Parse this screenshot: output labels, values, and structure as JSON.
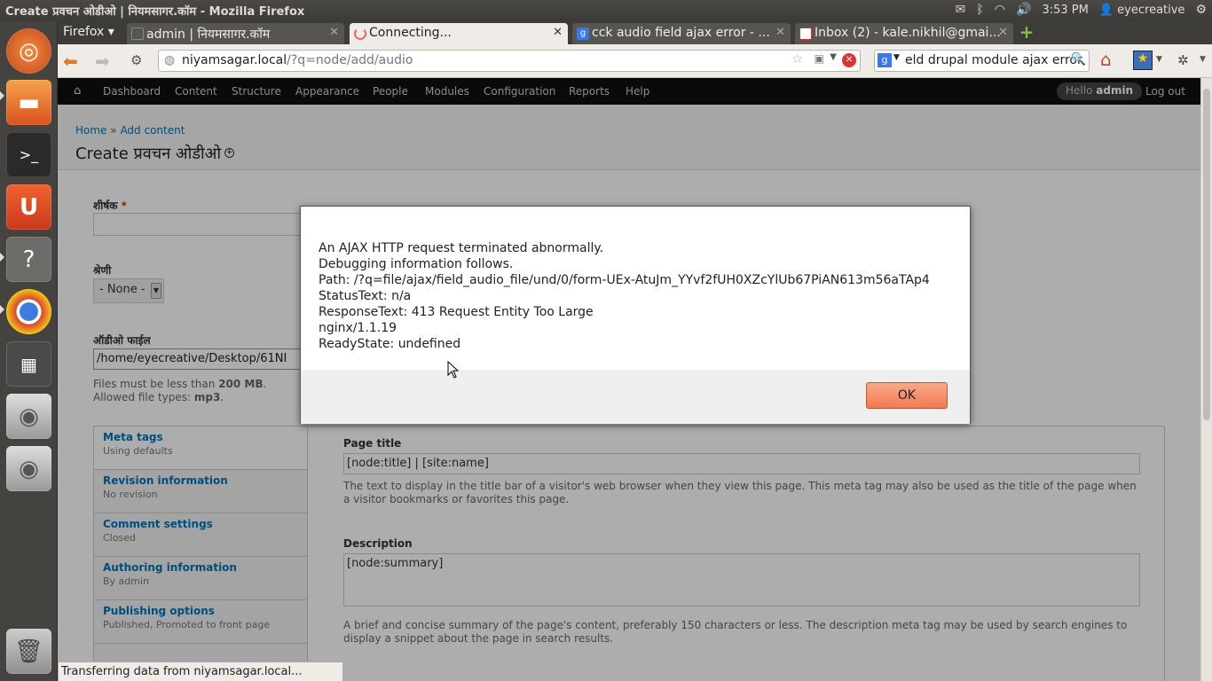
{
  "window": {
    "title": "Create प्रवचन ओडीओ | नियमसागर.कॉम - Mozilla Firefox"
  },
  "tray": {
    "time": "3:53 PM",
    "user": "eyecreative"
  },
  "browser": {
    "firefox_menu": "Firefox",
    "tabs": [
      {
        "label": "admin | नियमसागर.कॉम",
        "active": false
      },
      {
        "label": "Connecting...",
        "active": true
      },
      {
        "label": "cck audio field ajax error - ...",
        "active": false
      },
      {
        "label": "Inbox (2) - kale.nikhil@gmai...",
        "active": false
      }
    ],
    "url_host": "niyamsagar.local",
    "url_path": "/?q=node/add/audio",
    "search_value": "eld drupal module ajax error"
  },
  "admin_toolbar": {
    "items": [
      "Dashboard",
      "Content",
      "Structure",
      "Appearance",
      "People",
      "Modules",
      "Configuration",
      "Reports",
      "Help"
    ],
    "hello_prefix": "Hello",
    "hello_user": "admin",
    "logout": "Log out"
  },
  "header": {
    "breadcrumb": [
      "Home",
      "Add content"
    ],
    "breadcrumb_sep": "»",
    "title": "Create प्रवचन ओडीओ"
  },
  "form": {
    "title_label": "शीर्षक",
    "required_mark": "*",
    "category_label": "श्रेणी",
    "category_value": "- None -",
    "audio_label": "ऑडीओ फाईल",
    "file_path": "/home/eyecreative/Desktop/61NI",
    "size_note_prefix": "Files must be less than",
    "size_note_value": "200 MB",
    "types_note_prefix": "Allowed file types:",
    "types_note_value": "mp3"
  },
  "vertical_tabs": [
    {
      "title": "Meta tags",
      "summary": "Using defaults"
    },
    {
      "title": "Revision information",
      "summary": "No revision"
    },
    {
      "title": "Comment settings",
      "summary": "Closed"
    },
    {
      "title": "Authoring information",
      "summary": "By admin"
    },
    {
      "title": "Publishing options",
      "summary": "Published, Promoted to front page"
    }
  ],
  "meta_pane": {
    "page_title_label": "Page title",
    "page_title_value": "[node:title] | [site:name]",
    "page_title_desc": "The text to display in the title bar of a visitor's web browser when they view this page. This meta tag may also be used as the title of the page when a visitor bookmarks or favorites this page.",
    "description_label": "Description",
    "description_value": "[node:summary]",
    "description_desc": "A brief and concise summary of the page's content, preferably 150 characters or less. The description meta tag may be used by search engines to display a snippet about the page in search results."
  },
  "dialog": {
    "lines": [
      "An AJAX HTTP request terminated abnormally.",
      "Debugging information follows.",
      "Path: /?q=file/ajax/field_audio_file/und/0/form-UEx-AtuJm_YYvf2fUH0XZcYlUb67PiAN613m56aTAp4",
      "StatusText: n/a",
      "ResponseText: 413 Request Entity Too Large",
      "nginx/1.1.19",
      "ReadyState: undefined"
    ],
    "ok_label": "OK"
  },
  "status_bar": "Transferring data from niyamsagar.local...",
  "colors": {
    "accent": "#f07b52",
    "link": "#0074bd",
    "toolbar": "#0f0f0f"
  }
}
